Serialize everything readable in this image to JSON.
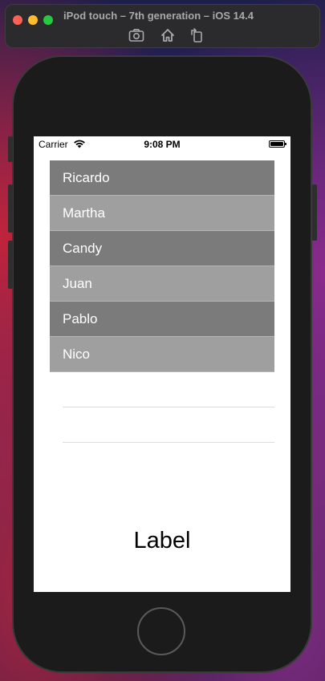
{
  "window": {
    "title": "iPod touch – 7th generation – iOS 14.4",
    "toolbar": {
      "screenshot_icon": "camera-icon",
      "home_icon": "home-icon",
      "rotate_icon": "rotate-icon"
    },
    "traffic_lights": {
      "close": "#fe5f57",
      "minimize": "#febc2e",
      "zoom": "#28c840"
    }
  },
  "status_bar": {
    "carrier": "Carrier",
    "time": "9:08 PM",
    "wifi_icon": "wifi-icon",
    "battery_icon": "battery-icon"
  },
  "table": {
    "rows": [
      {
        "label": "Ricardo",
        "style": "dark"
      },
      {
        "label": "Martha",
        "style": "light"
      },
      {
        "label": "Candy",
        "style": "dark"
      },
      {
        "label": "Juan",
        "style": "light"
      },
      {
        "label": "Pablo",
        "style": "dark"
      },
      {
        "label": "Nico",
        "style": "light"
      }
    ],
    "colors": {
      "dark_row": "#7b7b7b",
      "light_row": "#9f9f9f"
    }
  },
  "main_label": "Label"
}
